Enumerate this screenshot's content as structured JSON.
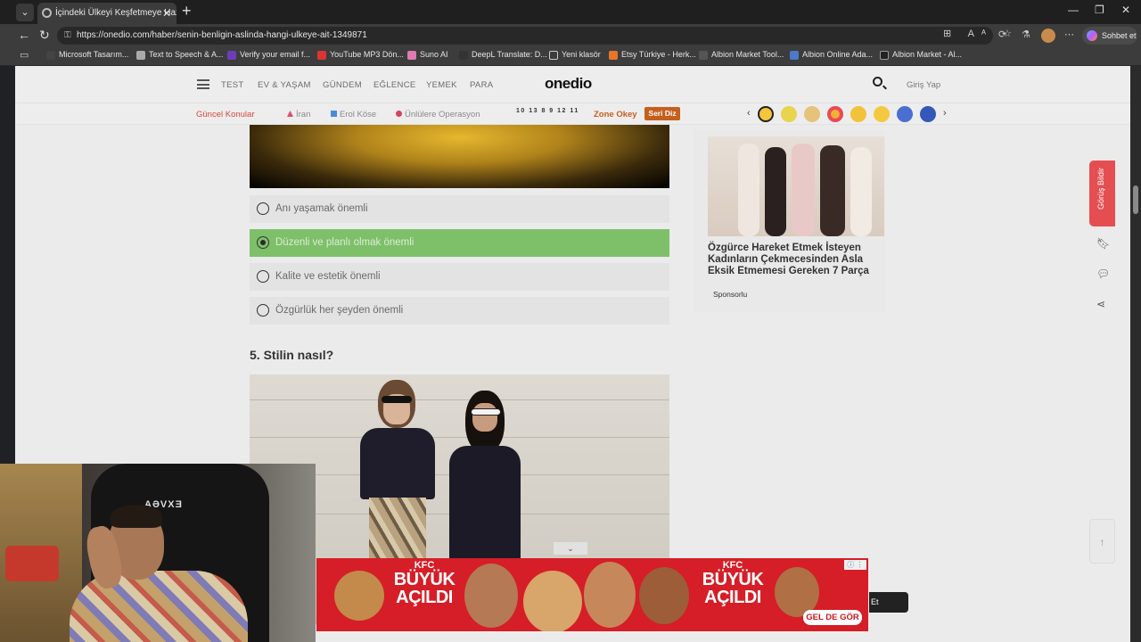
{
  "browser": {
    "tab_title": "İçindeki Ülkeyi Keşfetmeye Hazır mı",
    "url": "https://onedio.com/haber/senin-benligin-aslinda-hangi-ulkeye-ait-1349871",
    "copilot_label": "Sohbet et",
    "bookmarks": [
      "Microsoft Tasarım...",
      "Text to Speech & A...",
      "Verify your email f...",
      "YouTube MP3 Dön...",
      "Suno AI",
      "DeepL Translate: D...",
      "Yeni klasör",
      "Etsy Türkiye - Herk...",
      "Albion Market Tool...",
      "Albion Online Ada...",
      "Albion Market - Al..."
    ]
  },
  "site": {
    "logo": "onedio",
    "nav": [
      "TEST",
      "EV & YAŞAM",
      "GÜNDEM",
      "EĞLENCE",
      "YEMEK",
      "PARA"
    ],
    "login": "Giriş Yap",
    "trending_title": "Güncel Konular",
    "trending": [
      "İran",
      "Erol Köse",
      "Ünlülere Operasyon"
    ],
    "scores": "10 13 8 9 12 11",
    "zone_label": "Zone Okey",
    "seri_label": "Seri Diz"
  },
  "quiz": {
    "options": [
      {
        "label": "Anı yaşamak önemli",
        "selected": false
      },
      {
        "label": "Düzenli ve planlı olmak önemli",
        "selected": true
      },
      {
        "label": "Kalite ve estetik önemli",
        "selected": false
      },
      {
        "label": "Özgürlük her şeyden önemli",
        "selected": false
      }
    ],
    "question_5": "5. Stilin nasıl?"
  },
  "sidebar": {
    "card_title": "Özgürce Hareket Etmek İsteyen Kadınların Çekmecesinden Asla Eksik Etmemesi Gereken 7 Parça",
    "sponsor": "Sponsorlu",
    "feedback": "Görüş Bildir"
  },
  "ad": {
    "brand": "KFC",
    "headline_1": "BÜYÜK",
    "headline_2": "AÇILDI",
    "cta": "GEL DE GÖR",
    "partial_button": "Et"
  },
  "webcam": {
    "chair_brand": "AƏVXƎ"
  }
}
